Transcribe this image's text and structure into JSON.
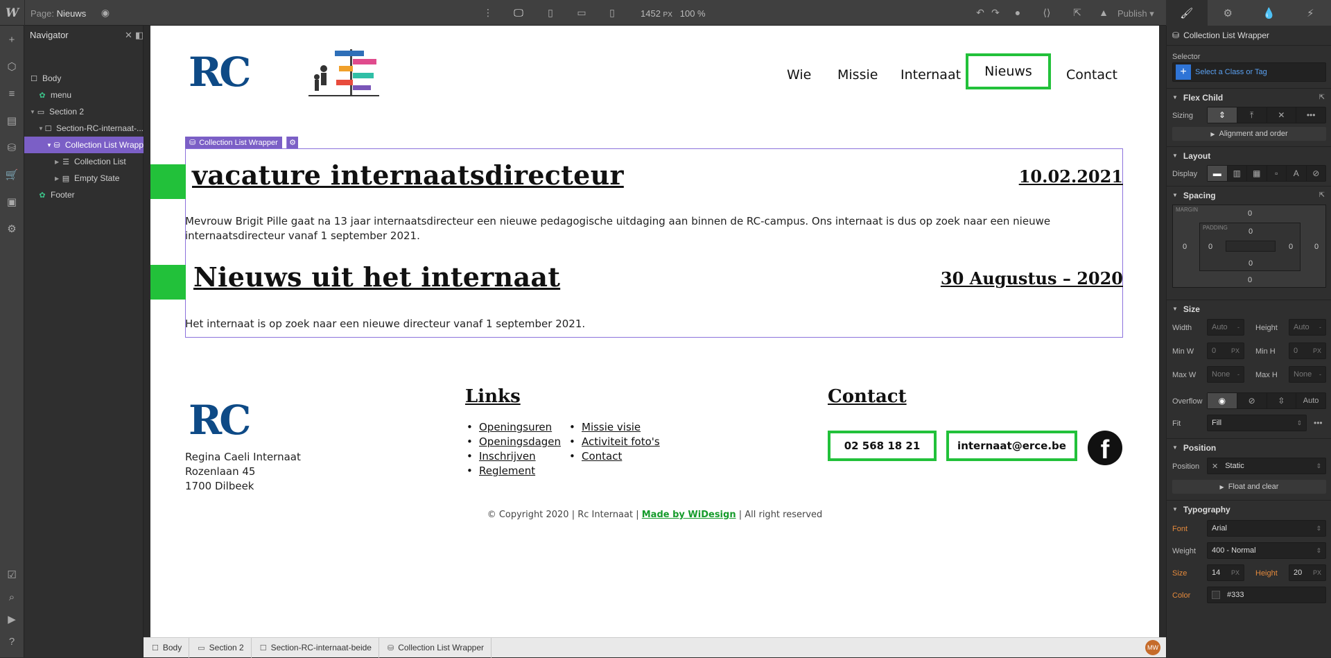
{
  "topbar": {
    "logo": "W",
    "page_prefix": "Page:",
    "page_name": "Nieuws",
    "canvas_width": "1452",
    "canvas_unit": "PX",
    "zoom": "100 %",
    "publish_label": "Publish"
  },
  "navigator": {
    "title": "Navigator",
    "items": [
      {
        "label": "Body"
      },
      {
        "label": "menu"
      },
      {
        "label": "Section 2"
      },
      {
        "label": "Section-RC-internaat-..."
      },
      {
        "label": "Collection List Wrapp"
      },
      {
        "label": "Collection List"
      },
      {
        "label": "Empty State"
      },
      {
        "label": "Footer"
      }
    ]
  },
  "site": {
    "logo_text": "RC",
    "nav": [
      "Wie",
      "Missie",
      "Internaat",
      "Nieuws",
      "Contact"
    ],
    "wrapper_tag": "Collection List Wrapper",
    "posts": [
      {
        "title": "vacature internaatsdirecteur",
        "date": "10.02.2021",
        "body": "Mevrouw Brigit Pille gaat na 13 jaar internaatsdirecteur een nieuwe pedagogische uitdaging aan binnen de RC-campus. Ons internaat is dus op zoek naar een nieuwe internaatsdirecteur vanaf 1 september 2021."
      },
      {
        "title": "Nieuws uit het internaat",
        "date": "30 Augustus – 2020",
        "body": "Het internaat is op zoek naar een nieuwe directeur vanaf 1 september 2021."
      }
    ],
    "footer": {
      "address": [
        "Regina Caeli Internaat",
        "Rozenlaan 45",
        "1700 Dilbeek"
      ],
      "links_title": "Links",
      "links_col1": [
        "Openingsuren",
        "Openingsdagen",
        "Inschrijven",
        "Reglement"
      ],
      "links_col2": [
        "Missie visie",
        "Activiteit foto's",
        "Contact"
      ],
      "contact_title": "Contact",
      "phone": "02 568 18 21",
      "email": "internaat@erce.be",
      "fb_glyph": "f",
      "copyright_left": "© Copyright 2020 |  Rc Internaat |",
      "copyright_link": "Made by WiDesign",
      "copyright_right": "|   All right reserved"
    }
  },
  "breadcrumb": [
    "Body",
    "Section 2",
    "Section-RC-internaat-beide",
    "Collection List Wrapper"
  ],
  "user_badge": "MW",
  "panel": {
    "element_name": "Collection List Wrapper",
    "selector_label": "Selector",
    "selector_placeholder": "Select a Class or Tag",
    "flex_child": "Flex Child",
    "sizing_label": "Sizing",
    "alignment_btn": "Alignment and order",
    "layout": "Layout",
    "display_label": "Display",
    "spacing": "Spacing",
    "margin_label": "MARGIN",
    "padding_label": "PADDING",
    "spacing_values": {
      "margin_top": "0",
      "margin_bottom": "0",
      "margin_left": "0",
      "margin_right": "0",
      "padding_top": "0",
      "padding_bottom": "0",
      "padding_left": "0",
      "padding_right": "0"
    },
    "size": "Size",
    "width_label": "Width",
    "height_label": "Height",
    "minw_label": "Min W",
    "minh_label": "Min H",
    "maxw_label": "Max W",
    "maxh_label": "Max H",
    "auto": "Auto",
    "zero": "0",
    "none": "None",
    "px": "PX",
    "overflow_label": "Overflow",
    "overflow_auto": "Auto",
    "fit_label": "Fit",
    "fit_value": "Fill",
    "position": "Position",
    "position_label": "Position",
    "position_value": "Static",
    "float_btn": "Float and clear",
    "typography": "Typography",
    "font_label": "Font",
    "font_value": "Arial",
    "weight_label": "Weight",
    "weight_value": "400 - Normal",
    "size_label": "Size",
    "size_value": "14",
    "lineheight_label": "Height",
    "lineheight_value": "20",
    "color_label": "Color",
    "color_value": "#333"
  }
}
